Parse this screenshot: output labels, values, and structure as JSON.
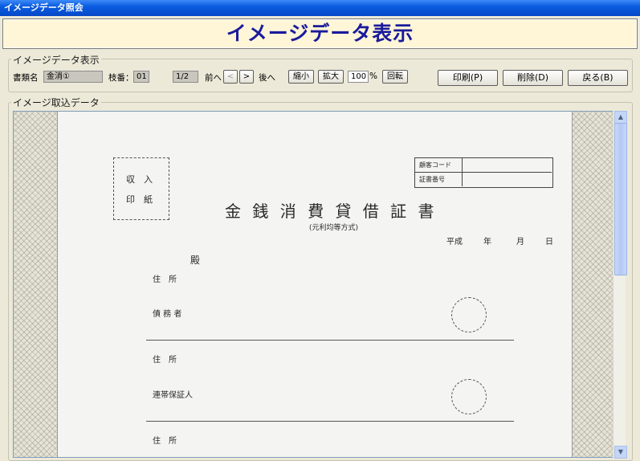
{
  "window": {
    "title": "イメージデータ照会"
  },
  "banner": {
    "title": "イメージデータ表示"
  },
  "display_group": {
    "legend": "イメージデータ表示",
    "doc_type_label": "書類名",
    "doc_type_value": "金消①",
    "page_no_label": "枝番：",
    "page_no_value": "01",
    "page_count": "1/2",
    "prev_label": "前へ",
    "prev_button": "<",
    "next_button": ">",
    "next_label": "後へ",
    "zoom_out": "縮小",
    "zoom_in": "拡大",
    "zoom_value": "100",
    "zoom_unit": "%",
    "rotate": "回転",
    "print": "印刷(P)",
    "delete": "削除(D)",
    "back": "戻る(B)"
  },
  "image_group": {
    "legend": "イメージ取込データ"
  },
  "document": {
    "stamp_line1": "収　入",
    "stamp_line2": "印　紙",
    "customer_code_label": "顧客コード",
    "certificate_no_label": "証書番号",
    "title": "金 銭 消 費 貸 借 証 書",
    "subtitle": "(元利均等方式)",
    "era": "平成",
    "year": "年",
    "month": "月",
    "day": "日",
    "addressee": "殿",
    "address1": "住　所",
    "debtor": "債 務 者",
    "address2": "住　所",
    "guarantor": "連帯保証人",
    "address3": "住　所"
  },
  "scrollbar": {
    "up_arrow": "▲",
    "down_arrow": "▼",
    "position_fraction": 0
  }
}
